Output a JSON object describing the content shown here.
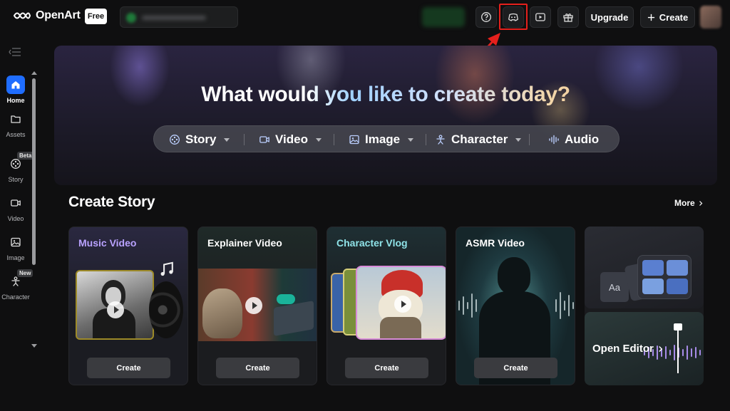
{
  "header": {
    "brand": "OpenArt",
    "plan_badge": "Free",
    "upgrade_label": "Upgrade",
    "create_label": "Create",
    "icons": [
      "help-icon",
      "discord-icon",
      "video-play-icon",
      "gift-icon",
      "plus-icon"
    ]
  },
  "sidebar": {
    "items": [
      {
        "label": "Home",
        "icon": "home-icon",
        "active": true
      },
      {
        "label": "Assets",
        "icon": "folder-icon"
      },
      {
        "label": "Story",
        "icon": "film-reel-icon",
        "badge": "Beta"
      },
      {
        "label": "Video",
        "icon": "video-camera-icon"
      },
      {
        "label": "Image",
        "icon": "image-icon"
      },
      {
        "label": "Character",
        "icon": "character-icon",
        "badge": "New"
      }
    ]
  },
  "hero": {
    "title": "What would you like to create today?",
    "pills": [
      {
        "label": "Story",
        "icon": "film-reel-icon"
      },
      {
        "label": "Video",
        "icon": "video-camera-icon"
      },
      {
        "label": "Image",
        "icon": "image-icon"
      },
      {
        "label": "Character",
        "icon": "character-icon"
      },
      {
        "label": "Audio",
        "icon": "audio-wave-icon"
      }
    ]
  },
  "section": {
    "title": "Create Story",
    "more_label": "More"
  },
  "cards": [
    {
      "title": "Music Video",
      "title_color": "#b9a2ff",
      "button": "Create"
    },
    {
      "title": "Explainer Video",
      "title_color": "#ffffff",
      "button": "Create"
    },
    {
      "title": "Character Vlog",
      "title_color": "#8fe3e8",
      "button": "Create"
    },
    {
      "title": "ASMR Video",
      "title_color": "#ffffff",
      "button": "Create"
    }
  ],
  "editor": {
    "label": "Open Editor",
    "thumb_text": "Aa"
  },
  "colors": {
    "accent": "#1f6dff",
    "highlight": "#e5201c"
  }
}
